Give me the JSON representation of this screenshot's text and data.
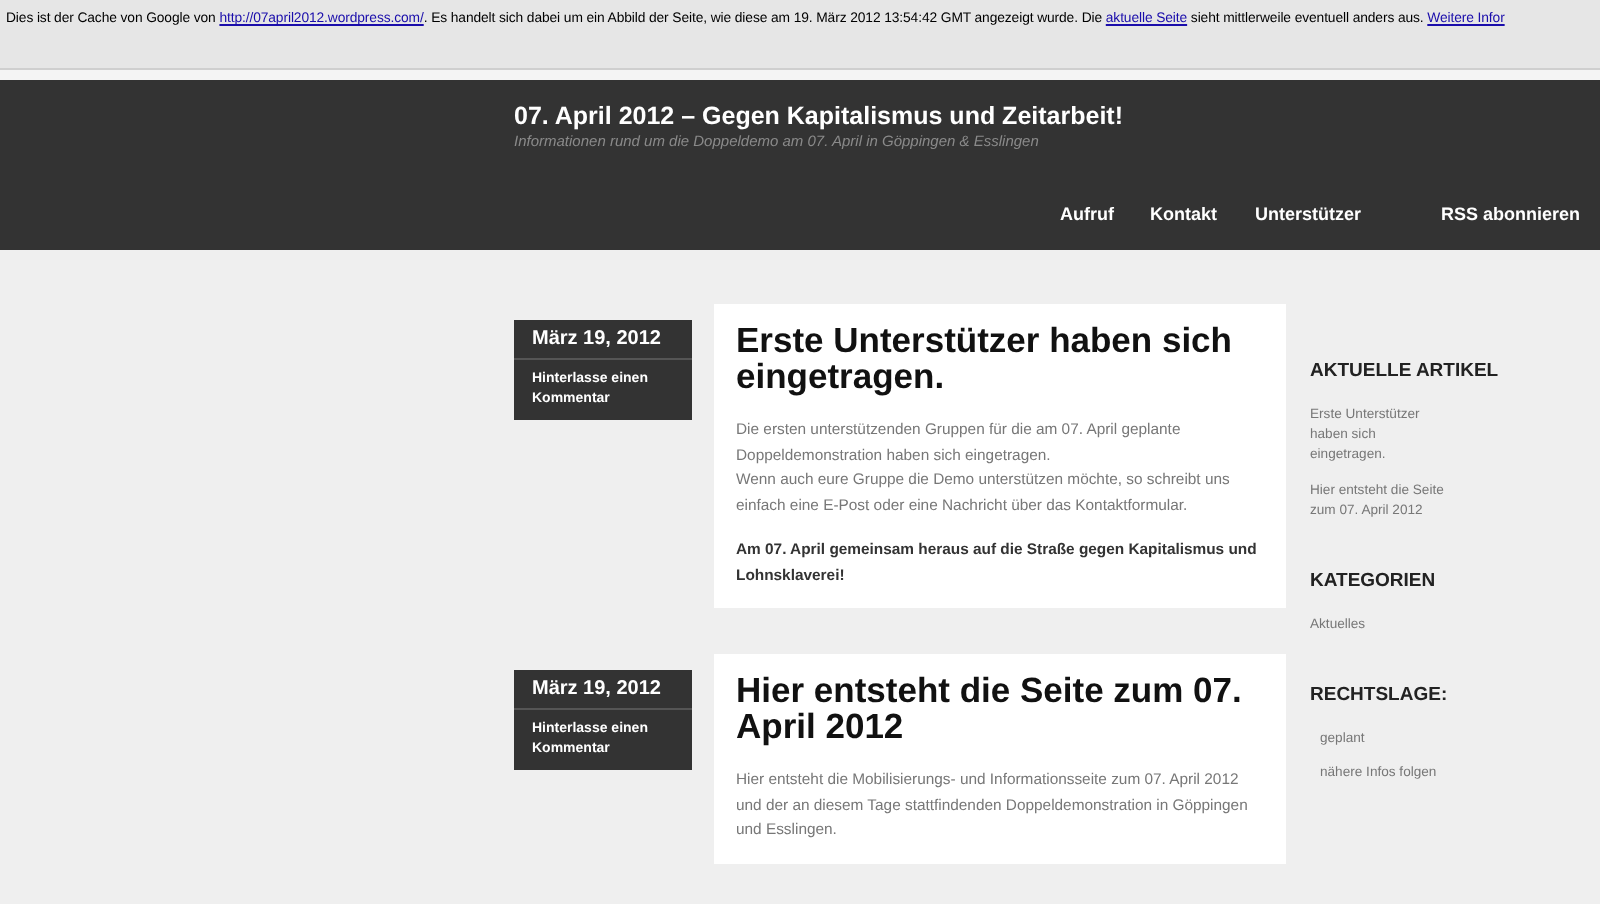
{
  "cache_banner": {
    "parts": [
      {
        "kind": "text",
        "text": "Dies ist der Cache von Google von "
      },
      {
        "kind": "link",
        "text": "http://07april2012.wordpress.com/"
      },
      {
        "kind": "text",
        "text": ". Es handelt sich dabei um ein Abbild der Seite, wie diese am 19. März 2012 13:54:42 GMT angezeigt wurde. Die "
      },
      {
        "kind": "link",
        "text": "aktuelle Seite"
      },
      {
        "kind": "text",
        "text": " sieht mittlerweile eventuell anders aus. "
      },
      {
        "kind": "link",
        "text": "Weitere Infor"
      }
    ]
  },
  "header": {
    "title": "07. April 2012 – Gegen Kapitalismus und Zeitarbeit!",
    "tagline": "Informationen rund um die Doppeldemo am 07. April in Göppingen & Esslingen",
    "nav": [
      "Aufruf",
      "Kontakt",
      "Unterstützer",
      "RSS abonnieren"
    ]
  },
  "posts": [
    {
      "date": "März 19, 2012",
      "comment_link": "Hinterlasse einen Kommentar",
      "title": "Erste Unterstützer haben sich eingetragen.",
      "paragraphs": [
        {
          "bold": false,
          "lines": [
            "Die ersten unterstützenden Gruppen für die am 07. April geplante Doppeldemonstration haben sich eingetragen.",
            "Wenn auch eure Gruppe die Demo unterstützen möchte, so schreibt uns einfach eine E-Post oder eine Nachricht über das Kontaktformular."
          ]
        },
        {
          "bold": true,
          "lines": [
            "Am 07. April gemeinsam heraus auf die Straße gegen Kapitalismus und Lohnsklaverei!"
          ]
        }
      ]
    },
    {
      "date": "März 19, 2012",
      "comment_link": "Hinterlasse einen Kommentar",
      "title": "Hier entsteht die Seite zum 07. April 2012",
      "paragraphs": [
        {
          "bold": false,
          "lines": [
            "Hier entsteht die Mobilisierungs- und Informationsseite zum 07. April 2012 und der an diesem Tage stattfindenden Doppeldemonstration in Göppingen und Esslingen."
          ]
        }
      ]
    }
  ],
  "sidebar": [
    {
      "heading": "AKTUELLE ARTIKEL",
      "kind": "links",
      "items": [
        "Erste Unterstützer haben sich eingetragen.",
        "Hier entsteht die Seite zum 07. April 2012"
      ]
    },
    {
      "heading": "KATEGORIEN",
      "kind": "links",
      "items": [
        "Aktuelles"
      ]
    },
    {
      "heading": "RECHTSLAGE:",
      "kind": "text",
      "items": [
        "geplant",
        "nähere Infos folgen"
      ]
    }
  ]
}
